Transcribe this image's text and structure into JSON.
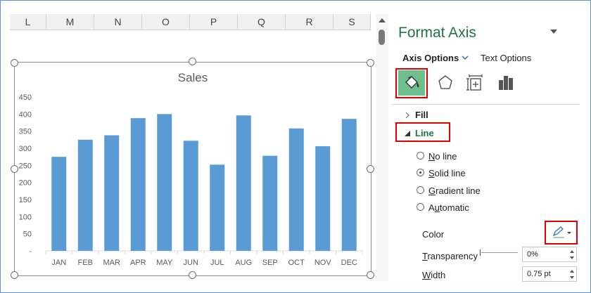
{
  "sheet": {
    "columns": [
      "L",
      "M",
      "N",
      "O",
      "P",
      "Q",
      "R",
      "S"
    ]
  },
  "chart_data": {
    "type": "bar",
    "title": "Sales",
    "categories": [
      "JAN",
      "FEB",
      "MAR",
      "APR",
      "MAY",
      "JUN",
      "JUL",
      "AUG",
      "SEP",
      "OCT",
      "NOV",
      "DEC"
    ],
    "values": [
      275,
      325,
      338,
      388,
      400,
      322,
      252,
      396,
      278,
      358,
      306,
      386
    ],
    "ylim": [
      0,
      450
    ],
    "yticks": [
      "-",
      "50",
      "100",
      "150",
      "200",
      "250",
      "300",
      "350",
      "400",
      "450"
    ],
    "bar_color": "#5b9bd5",
    "grid": false,
    "legend": "none"
  },
  "pane": {
    "title": "Format Axis",
    "tab_axis_options": "Axis Options",
    "tab_text_options": "Text Options",
    "icons": [
      "fill-line-icon",
      "effects-pentagon-icon",
      "size-properties-icon",
      "axis-options-bars-icon"
    ],
    "section_fill": "Fill",
    "section_line": "Line",
    "options": [
      {
        "accel": "N",
        "rest": "o line",
        "selected": false
      },
      {
        "accel": "S",
        "rest": "olid line",
        "selected": true
      },
      {
        "accel": "G",
        "rest": "radient line",
        "selected": false
      },
      {
        "accel": "",
        "pre": "A",
        "accel2": "u",
        "rest": "tomatic",
        "selected": false
      }
    ],
    "color_label": "Color",
    "transparency_label_accel": "T",
    "transparency_label_rest": "ransparency",
    "transparency_value": "0%",
    "width_label_accel": "W",
    "width_label_rest": "idth",
    "width_value": "0.75 pt",
    "accent": "#217346",
    "highlight": "#e00000"
  }
}
